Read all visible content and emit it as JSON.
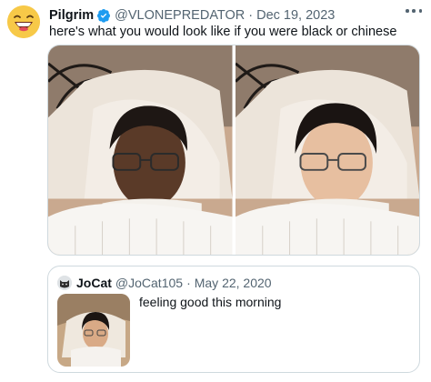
{
  "tweet": {
    "display_name": "Pilgrim",
    "handle": "@VLONEPREDATOR",
    "separator": "·",
    "date": "Dec 19, 2023",
    "text": "here's what you would look like if you were black or chinese",
    "avatar_icon": "laughing-emoji-icon",
    "verified_icon": "verified-badge-icon",
    "more_icon": "more-options-icon",
    "media": [
      {
        "name": "photo-1",
        "skin": "#5a3a28",
        "hair": "#1e1714"
      },
      {
        "name": "photo-2",
        "skin": "#e7bfa0",
        "hair": "#1a1412"
      }
    ]
  },
  "quote": {
    "display_name": "JoCat",
    "handle": "@JoCat105",
    "separator": "·",
    "date": "May 22, 2020",
    "text": "feeling good this morning",
    "avatar_icon": "cat-avatar-icon"
  },
  "colors": {
    "primary_text": "#0f1419",
    "secondary_text": "#536471",
    "verified_blue": "#1d9bf0",
    "border": "#cfd9de"
  }
}
